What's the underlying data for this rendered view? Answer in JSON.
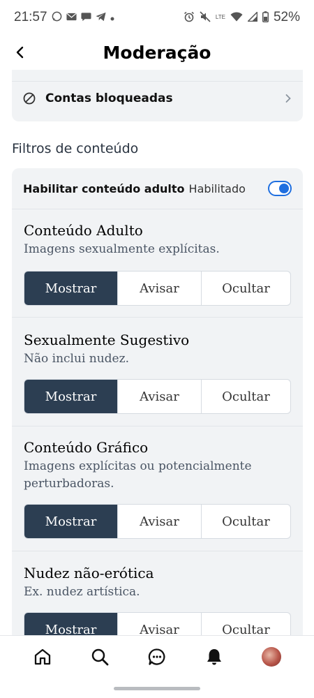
{
  "status_bar": {
    "time": "21:57",
    "lte_label": "LTE",
    "battery": "52%"
  },
  "header": {
    "title": "Moderação"
  },
  "blocked_accounts": {
    "label": "Contas bloqueadas"
  },
  "content_filters": {
    "heading": "Filtros de conteúdo",
    "adult_toggle": {
      "label": "Habilitar conteúdo adulto",
      "state": "Habilitado",
      "enabled": true
    },
    "filters": [
      {
        "title": "Conteúdo Adulto",
        "description": "Imagens sexualmente explícitas.",
        "selected": "Mostrar"
      },
      {
        "title": "Sexualmente Sugestivo",
        "description": "Não inclui nudez.",
        "selected": "Mostrar"
      },
      {
        "title": "Conteúdo Gráfico",
        "description": "Imagens explícitas ou potencialmente perturbadoras.",
        "selected": "Mostrar"
      },
      {
        "title": "Nudez não-erótica",
        "description": "Ex. nudez artística.",
        "selected": "Mostrar"
      }
    ],
    "options": [
      "Mostrar",
      "Avisar",
      "Ocultar"
    ]
  },
  "bottom_nav": {
    "items": [
      "home-icon",
      "search-icon",
      "chat-icon",
      "bell-icon",
      "avatar"
    ]
  },
  "colors": {
    "accent": "#1f6fe0",
    "selected_segment": "#2c3e52",
    "card_bg": "#f1f3f5"
  }
}
